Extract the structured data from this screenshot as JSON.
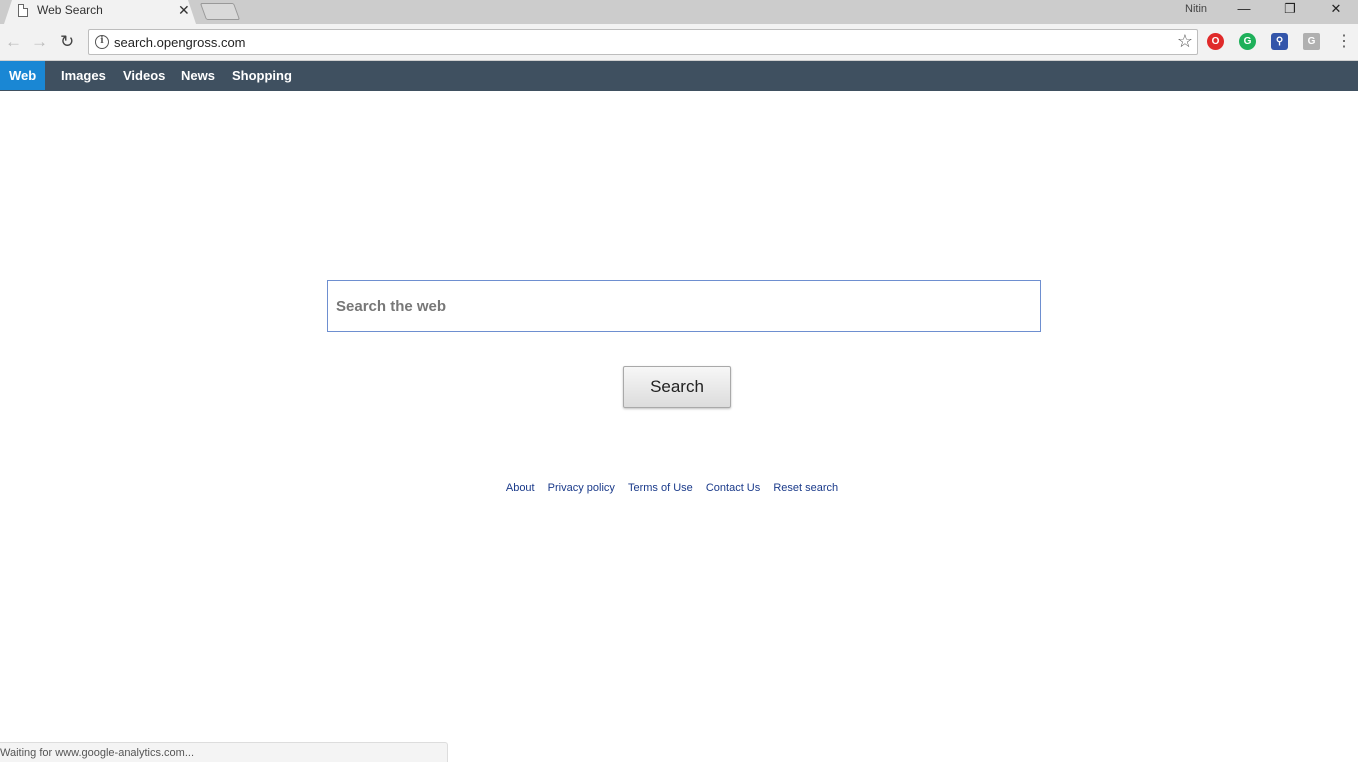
{
  "browser": {
    "tab": {
      "title": "Web Search",
      "close": "✕"
    },
    "profile_name": "Nitin",
    "window_controls": {
      "minimize": "—",
      "restore": "❐",
      "close": "✕"
    },
    "url": "search.opengross.com",
    "extensions": [
      {
        "name": "opera-extension-icon",
        "glyph": "O",
        "color": "#e02a2a"
      },
      {
        "name": "grammarly-icon",
        "glyph": "G",
        "color": "#1eb05a"
      },
      {
        "name": "search-extension-icon",
        "glyph": "⚲",
        "color": "#3355aa"
      },
      {
        "name": "google-extension-icon",
        "glyph": "G",
        "color": "#b0b0b0"
      }
    ]
  },
  "nav": {
    "items": [
      {
        "label": "Web",
        "active": true
      },
      {
        "label": "Images",
        "active": false
      },
      {
        "label": "Videos",
        "active": false
      },
      {
        "label": "News",
        "active": false
      },
      {
        "label": "Shopping",
        "active": false
      }
    ],
    "bar_color": "#3f5060",
    "active_color": "#1a87d4"
  },
  "search": {
    "placeholder": "Search the web",
    "button_label": "Search"
  },
  "footer": {
    "links": [
      "About",
      "Privacy policy",
      "Terms of Use",
      "Contact Us",
      "Reset search"
    ]
  },
  "status_text": "Waiting for www.google-analytics.com..."
}
